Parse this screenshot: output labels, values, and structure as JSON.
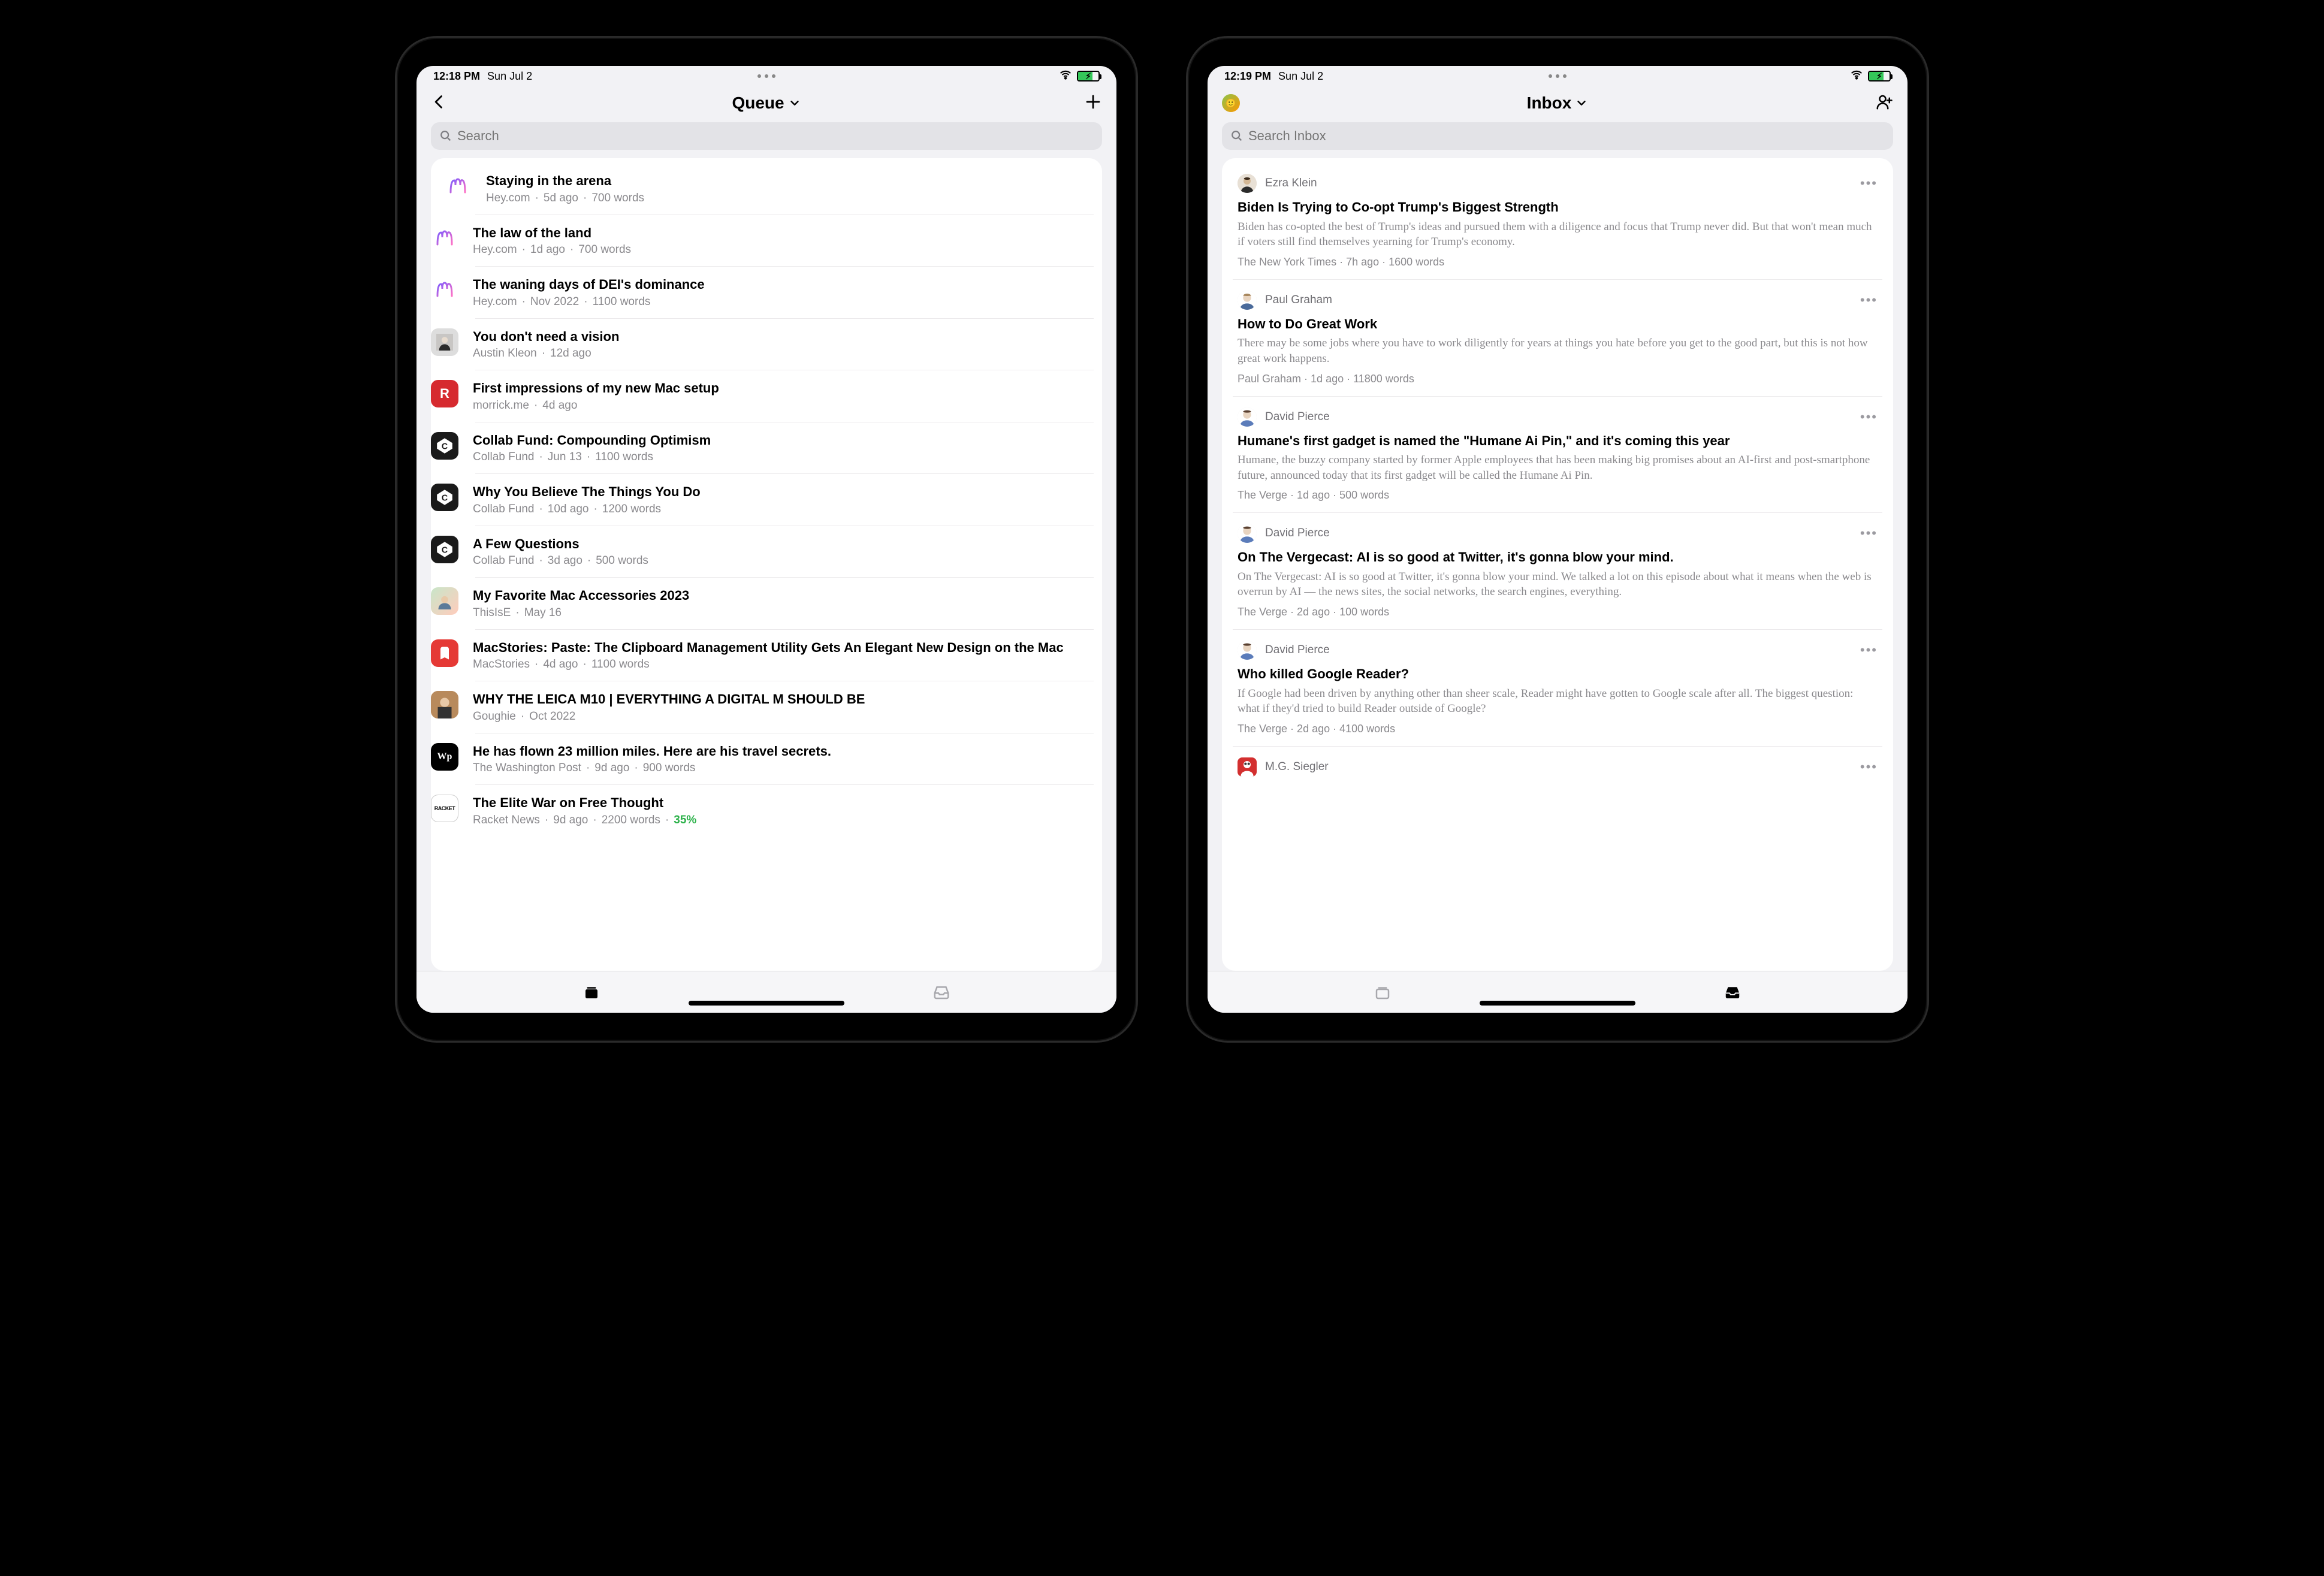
{
  "left": {
    "status": {
      "time": "12:18 PM",
      "date": "Sun Jul 2"
    },
    "nav": {
      "title": "Queue"
    },
    "search": {
      "placeholder": "Search"
    },
    "items": [
      {
        "icon": "hey",
        "title": "Staying in the arena",
        "source": "Hey.com",
        "age": "5d ago",
        "words": "700 words"
      },
      {
        "icon": "hey",
        "title": "The law of the land",
        "source": "Hey.com",
        "age": "1d ago",
        "words": "700 words"
      },
      {
        "icon": "hey",
        "title": "The waning days of DEI's dominance",
        "source": "Hey.com",
        "age": "Nov 2022",
        "words": "1100 words"
      },
      {
        "icon": "kleon",
        "title": "You don't need a vision",
        "source": "Austin Kleon",
        "age": "12d ago",
        "words": ""
      },
      {
        "icon": "red-r",
        "title": "First impressions of my new Mac setup",
        "source": "morrick.me",
        "age": "4d ago",
        "words": ""
      },
      {
        "icon": "collab",
        "title": "Collab Fund: Compounding Optimism",
        "source": "Collab Fund",
        "age": "Jun 13",
        "words": "1100 words"
      },
      {
        "icon": "collab",
        "title": "Why You Believe The Things You Do",
        "source": "Collab Fund",
        "age": "10d ago",
        "words": "1200 words"
      },
      {
        "icon": "collab",
        "title": "A Few Questions",
        "source": "Collab Fund",
        "age": "3d ago",
        "words": "500 words"
      },
      {
        "icon": "thisise",
        "title": "My Favorite Mac Accessories 2023",
        "source": "ThisIsE",
        "age": "May 16",
        "words": ""
      },
      {
        "icon": "macstories",
        "title": "MacStories: Paste: The Clipboard Management Utility Gets An Elegant New Design on the Mac",
        "source": "MacStories",
        "age": "4d ago",
        "words": "1100 words"
      },
      {
        "icon": "goughie",
        "title": "WHY THE LEICA M10 | EVERYTHING A DIGITAL M SHOULD BE",
        "source": "Goughie",
        "age": "Oct 2022",
        "words": ""
      },
      {
        "icon": "wapo",
        "title": "He has flown 23 million miles. Here are his travel secrets.",
        "source": "The Washington Post",
        "age": "9d ago",
        "words": "900 words"
      },
      {
        "icon": "racket",
        "title": "The Elite War on Free Thought",
        "source": "Racket News",
        "age": "9d ago",
        "words": "2200 words",
        "progress": "35%"
      }
    ],
    "tabs": {
      "active": "queue"
    }
  },
  "right": {
    "status": {
      "time": "12:19 PM",
      "date": "Sun Jul 2"
    },
    "nav": {
      "title": "Inbox"
    },
    "search": {
      "placeholder": "Search Inbox"
    },
    "items": [
      {
        "avatar": "ezra",
        "author": "Ezra Klein",
        "title": "Biden Is Trying to Co-opt Trump's Biggest Strength",
        "snippet": "Biden has co-opted the best of Trump's ideas and pursued them with a diligence and focus that Trump never did. But that won't mean much if voters still find themselves yearning for Trump's economy.",
        "source": "The New York Times",
        "age": "7h ago",
        "words": "1600 words"
      },
      {
        "avatar": "pg",
        "author": "Paul Graham",
        "title": "How to Do Great Work",
        "snippet": "There may be some jobs where you have to work diligently for years at things you hate before you get to the good part, but this is not how great work happens.",
        "source": "Paul Graham",
        "age": "1d ago",
        "words": "11800 words"
      },
      {
        "avatar": "pierce",
        "author": "David Pierce",
        "title": "Humane's first gadget is named the \"Humane Ai Pin,\" and it's coming this year",
        "snippet": "Humane, the buzzy company started by former Apple employees that has been making big promises about an AI-first and post-smartphone future, announced today that its first gadget will be called the Humane Ai Pin.",
        "source": "The Verge",
        "age": "1d ago",
        "words": "500 words"
      },
      {
        "avatar": "pierce",
        "author": "David Pierce",
        "title": "On The Vergecast: AI is so good at Twitter, it's gonna blow your mind.",
        "snippet": "On The Vergecast: AI is so good at Twitter, it's gonna blow your mind. We talked a lot on this episode about what it means when the web is overrun by AI — the news sites, the social networks, the search engines, everything.",
        "source": "The Verge",
        "age": "2d ago",
        "words": "100 words"
      },
      {
        "avatar": "pierce",
        "author": "David Pierce",
        "title": "Who killed Google Reader?",
        "snippet": "If Google had been driven by anything other than sheer scale, Reader might have gotten to Google scale after all. The biggest question: what if they'd tried to build Reader outside of Google?",
        "source": "The Verge",
        "age": "2d ago",
        "words": "4100 words"
      },
      {
        "avatar": "mg",
        "author": "M.G. Siegler",
        "title": "",
        "snippet": "",
        "source": "",
        "age": "",
        "words": ""
      }
    ],
    "tabs": {
      "active": "inbox"
    }
  }
}
